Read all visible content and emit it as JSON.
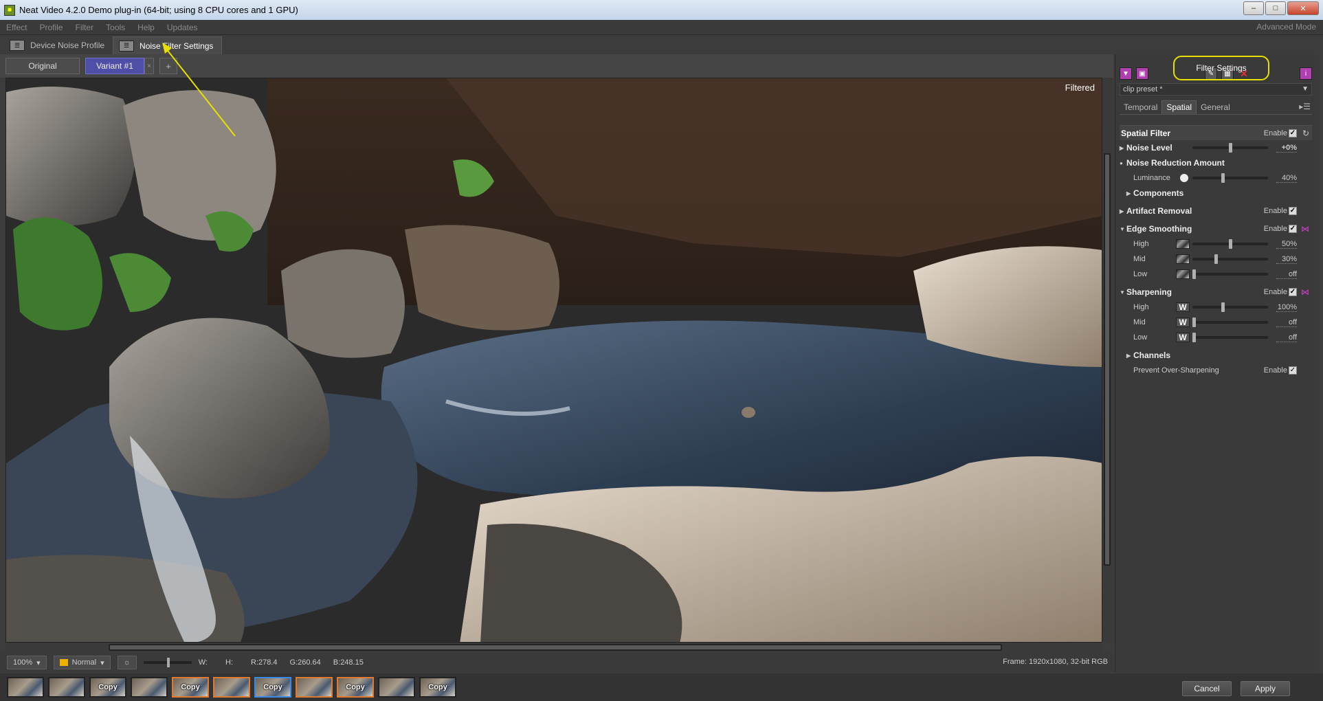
{
  "window": {
    "title": "Neat Video 4.2.0 Demo plug-in (64-bit; using 8 CPU cores and 1 GPU)",
    "btn_minimize": "–",
    "btn_maximize": "□",
    "btn_close": "✕"
  },
  "menu": {
    "items": [
      "Effect",
      "Profile",
      "Filter",
      "Tools",
      "Help",
      "Updates"
    ],
    "advanced_mode": "Advanced Mode"
  },
  "mode_tabs": [
    {
      "label": "Device Noise Profile",
      "active": false
    },
    {
      "label": "Noise Filter Settings",
      "active": true
    }
  ],
  "view_toolbar": {
    "original": "Original",
    "variant": "Variant #1",
    "close_glyph": "×",
    "add_glyph": "+"
  },
  "viewer": {
    "filtered_label": "Filtered"
  },
  "status": {
    "zoom": "100%",
    "blend_mode": "Normal",
    "w_label": "W:",
    "h_label": "H:",
    "r_value": "R:278.4",
    "g_value": "G:260.64",
    "b_value": "B:248.15",
    "frame_info": "Frame: 1920x1080, 32-bit RGB"
  },
  "thumbnails": [
    {
      "text": "",
      "border": "none"
    },
    {
      "text": "",
      "border": "none"
    },
    {
      "text": "Copy",
      "border": "none"
    },
    {
      "text": "",
      "border": "none"
    },
    {
      "text": "Copy",
      "border": "orange"
    },
    {
      "text": "",
      "border": "orange"
    },
    {
      "text": "Copy",
      "border": "blue"
    },
    {
      "text": "",
      "border": "orange"
    },
    {
      "text": "Copy",
      "border": "orange"
    },
    {
      "text": "",
      "border": "none"
    },
    {
      "text": "Copy",
      "border": "none"
    }
  ],
  "dialog": {
    "cancel": "Cancel",
    "apply": "Apply"
  },
  "filter_panel": {
    "title": "Filter Settings",
    "preset": "clip preset *",
    "tabs": [
      {
        "label": "Temporal",
        "active": false
      },
      {
        "label": "Spatial",
        "active": true
      },
      {
        "label": "General",
        "active": false
      }
    ],
    "enable_label": "Enable",
    "spatial_filter": "Spatial Filter",
    "noise_level": {
      "label": "Noise Level",
      "value": "+0%",
      "level": 0.5
    },
    "noise_reduction_amount": "Noise Reduction Amount",
    "luminance": {
      "label": "Luminance",
      "value": "40%",
      "level": 0.4
    },
    "components": "Components",
    "artifact_removal": "Artifact Removal",
    "edge_smoothing": {
      "label": "Edge Smoothing",
      "high": {
        "label": "High",
        "value": "50%",
        "level": 0.5
      },
      "mid": {
        "label": "Mid",
        "value": "30%",
        "level": 0.3
      },
      "low": {
        "label": "Low",
        "value": "off",
        "level": 0.0
      }
    },
    "sharpening": {
      "label": "Sharpening",
      "high": {
        "label": "High",
        "value": "100%",
        "level": 0.4
      },
      "mid": {
        "label": "Mid",
        "value": "off",
        "level": 0.0
      },
      "low": {
        "label": "Low",
        "value": "off",
        "level": 0.0
      }
    },
    "channels": "Channels",
    "prevent_over_sharpening": "Prevent Over-Sharpening",
    "check_glyph": "✓",
    "w_glyph": "W"
  },
  "colors": {
    "variant_accent": "#4f4fa8",
    "highlight_ring": "#e8e000",
    "arrow": "#e8e000",
    "thumb_orange": "#e07a30",
    "thumb_blue": "#3a8ae8"
  }
}
